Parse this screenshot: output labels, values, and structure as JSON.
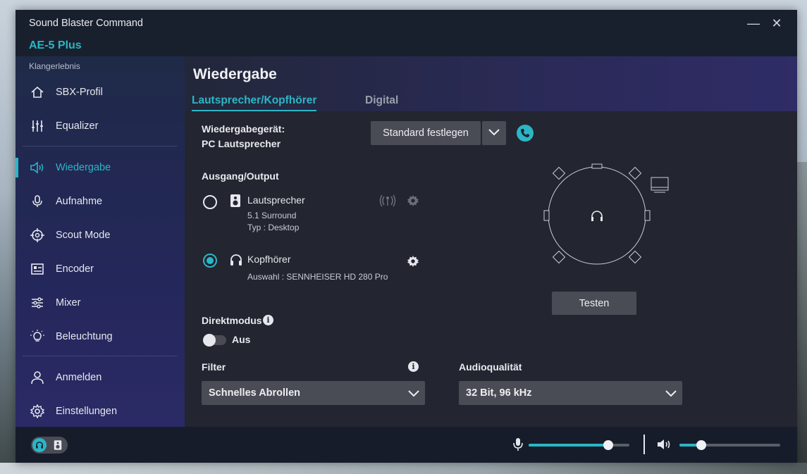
{
  "window": {
    "app_title": "Sound Blaster Command",
    "device_name": "AE-5 Plus",
    "minimize_glyph": "—",
    "close_glyph": "✕"
  },
  "sidebar": {
    "section_label": "Klangerlebnis",
    "items": [
      {
        "label": "SBX-Profil",
        "icon": "home-icon"
      },
      {
        "label": "Equalizer",
        "icon": "equalizer-icon"
      },
      {
        "label": "Wiedergabe",
        "icon": "speaker-icon",
        "active": true
      },
      {
        "label": "Aufnahme",
        "icon": "microphone-icon"
      },
      {
        "label": "Scout Mode",
        "icon": "crosshair-icon"
      },
      {
        "label": "Encoder",
        "icon": "encoder-icon"
      },
      {
        "label": "Mixer",
        "icon": "mixer-icon"
      },
      {
        "label": "Beleuchtung",
        "icon": "lightbulb-icon"
      },
      {
        "label": "Anmelden",
        "icon": "user-icon"
      },
      {
        "label": "Einstellungen",
        "icon": "gear-icon"
      }
    ]
  },
  "main": {
    "title": "Wiedergabe",
    "tabs": [
      {
        "label": "Lautsprecher/Kopfhörer",
        "active": true
      },
      {
        "label": "Digital",
        "active": false
      }
    ],
    "playback_device_label": "Wiedergabegerät:",
    "playback_device_value": "PC Lautsprecher",
    "set_default_button": "Standard festlegen",
    "output_label": "Ausgang/Output",
    "speakers": {
      "name": "Lautsprecher",
      "config": "5.1 Surround",
      "type": "Typ :  Desktop",
      "selected": false
    },
    "headphones": {
      "name": "Kopfhörer",
      "selection": "Auswahl :  SENNHEISER HD 280 Pro",
      "selected": true
    },
    "test_button": "Testen",
    "direct_mode_label": "Direktmodus",
    "direct_mode_state": "Aus",
    "filter_label": "Filter",
    "filter_value": "Schnelles Abrollen",
    "audio_quality_label": "Audioqualität",
    "audio_quality_value": "32 Bit, 96 kHz"
  },
  "bottombar": {
    "mic_volume": 0.79,
    "speaker_volume": 0.22,
    "output_mode": "headphones"
  },
  "colors": {
    "accent": "#2bb6c6",
    "button": "#4a4c55"
  }
}
